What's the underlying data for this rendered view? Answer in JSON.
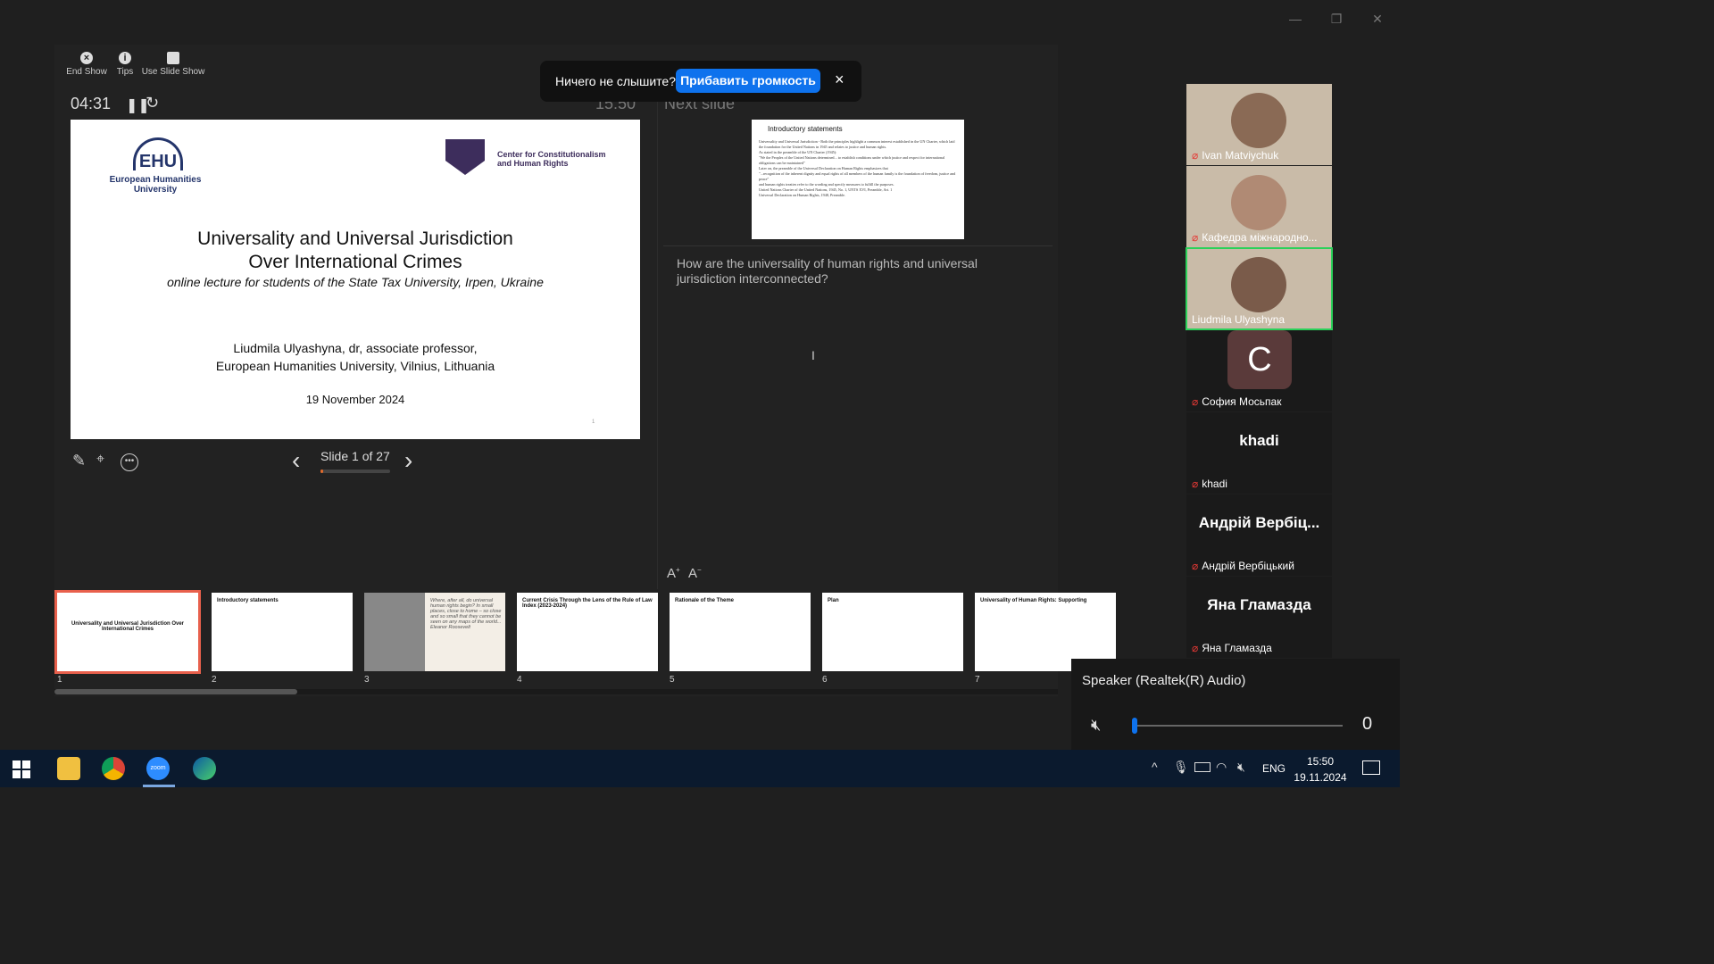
{
  "window_controls": {
    "minimize": "—",
    "restore": "❐",
    "close": "✕"
  },
  "toolbar": {
    "end_show": "End Show",
    "tips": "Tips",
    "use_slide_show": "Use Slide Show"
  },
  "timer": "04:31",
  "clock": "15:50",
  "next_slide_label": "Next slide",
  "notification": {
    "text": "Ничего не слышите?",
    "button": "Прибавить громкость",
    "close": "×"
  },
  "slide": {
    "ehu_logo": "EHU",
    "ehu_name_1": "European Humanities",
    "ehu_name_2": "University",
    "center_name_1": "Center for Constitutionalism",
    "center_name_2": "and Human Rights",
    "title_1": "Universality and Universal Jurisdiction",
    "title_2": "Over International Crimes",
    "subtitle_a": "online lecture for students of the",
    "subtitle_b": "State Tax University, Irpen, Ukraine",
    "author_1": "Liudmila Ulyashyna, dr, associate professor,",
    "author_2": "European Humanities University, Vilnius, Lithuania",
    "date": "19 November 2024",
    "page": "1"
  },
  "next_slide": {
    "title": "Introductory statements",
    "lines": [
      "Universality and Universal Jurisdiction - Both the principles highlight a common interest established in the UN Charter, which laid the foundation for the United Nations in 1945 and relates to justice and human rights.",
      "As stated in the preamble of the UN Charter (1945):",
      "\"We the Peoples of the United Nations determined... to establish conditions under which justice and respect for international obligations can be maintained\"",
      "Later on, the preamble of the Universal Declaration on Human Rights emphasizes that",
      "\"...recognition of the inherent dignity and equal rights of all members of the human family is the foundation of freedom, justice and peace\"",
      "and human rights treaties refer to the wording and specify measures to fulfill the purposes.",
      "United Nations Charter of the United Nations, 1945, No. 1, UNTS XVI, Preamble, Art. 1",
      "Universal Declaration on Human Rights, 1948, Preamble."
    ]
  },
  "notes": "How are the universality of human rights and universal jurisdiction interconnected?",
  "slide_counter": "Slide 1 of 27",
  "slide_progress": 0.037,
  "font_controls": {
    "increase": "A",
    "decrease": "A"
  },
  "thumbnails": [
    {
      "num": "1",
      "title": "Universality and Universal Jurisdiction Over International Crimes",
      "selected": true
    },
    {
      "num": "2",
      "title": "Introductory statements",
      "selected": false
    },
    {
      "num": "3",
      "title": "Where, after all, do universal human rights begin? In small places, close to home – so close and so small that they cannot be seen on any maps of the world... Eleanor Roosevelt",
      "selected": false
    },
    {
      "num": "4",
      "title": "Current Crisis Through the Lens of the Rule of Law Index (2023-2024)",
      "selected": false
    },
    {
      "num": "5",
      "title": "Rationale of the Theme",
      "selected": false
    },
    {
      "num": "6",
      "title": "Plan",
      "selected": false
    },
    {
      "num": "7",
      "title": "Universality of Human Rights: Supporting",
      "selected": false
    }
  ],
  "participants": [
    {
      "name": "Ivan Matviychuk",
      "muted": true,
      "type": "video"
    },
    {
      "name": "Кафедра міжнародно...",
      "muted": true,
      "type": "video"
    },
    {
      "name": "Liudmila Ulyashyna",
      "muted": false,
      "type": "video",
      "speaking": true
    },
    {
      "name": "София Мосьпак",
      "muted": true,
      "type": "avatar",
      "avatar_letter": "С"
    },
    {
      "name": "khadi",
      "muted": true,
      "type": "name",
      "big_name": "khadi"
    },
    {
      "name": "Андрій Вербіцький",
      "muted": true,
      "type": "name",
      "big_name": "Андрій Вербіц..."
    },
    {
      "name": "Яна Гламазда",
      "muted": true,
      "type": "name",
      "big_name": "Яна Гламазда"
    }
  ],
  "audio_panel": {
    "device": "Speaker (Realtek(R) Audio)",
    "volume": "0",
    "volume_level": 0.0
  },
  "taskbar": {
    "lang": "ENG",
    "time": "15:50",
    "date": "19.11.2024"
  },
  "colors": {
    "accent_blue": "#0e72ed",
    "selected_thumb": "#e8604c",
    "speaking_border": "#2bd15a",
    "muted_red": "#e53935"
  }
}
